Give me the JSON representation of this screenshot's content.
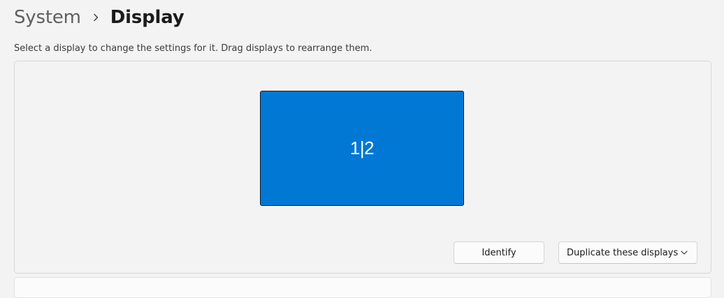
{
  "breadcrumb": {
    "parent": "System",
    "current": "Display",
    "separator_icon": "chevron-right-icon"
  },
  "instructions": "Select a display to change the settings for it. Drag displays to rearrange them.",
  "arrangement": {
    "monitor_label": "1|2",
    "monitor_color": "#0078d4"
  },
  "actions": {
    "identify_label": "Identify",
    "multiple_displays": {
      "selected": "Duplicate these displays",
      "icon": "chevron-down-icon"
    }
  }
}
